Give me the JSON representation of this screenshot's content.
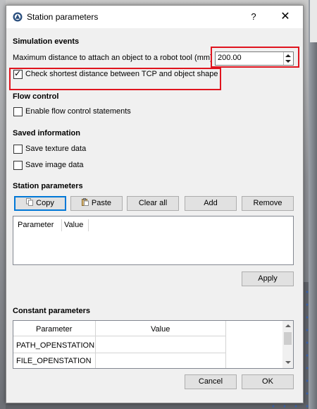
{
  "dialog": {
    "title": "Station parameters",
    "help": "?",
    "close": "✕"
  },
  "simulation_events": {
    "heading": "Simulation events",
    "max_distance_label": "Maximum distance to attach an object to a robot tool (mm)",
    "max_distance_value": "200.00",
    "check_shortest_label": "Check shortest distance between TCP and object shape",
    "check_shortest_checked": true
  },
  "flow_control": {
    "heading": "Flow control",
    "enable_label": "Enable flow control statements",
    "enable_checked": false
  },
  "saved_information": {
    "heading": "Saved information",
    "texture_label": "Save texture data",
    "image_label": "Save image data"
  },
  "station_parameters": {
    "heading": "Station parameters",
    "buttons": {
      "copy": "Copy",
      "paste": "Paste",
      "clear_all": "Clear all",
      "add": "Add",
      "remove": "Remove"
    },
    "columns": [
      "Parameter",
      "Value"
    ],
    "apply": "Apply"
  },
  "constant_parameters": {
    "heading": "Constant parameters",
    "columns": [
      "Parameter",
      "Value"
    ],
    "rows": [
      {
        "parameter": "PATH_OPENSTATION",
        "value": ""
      },
      {
        "parameter": "FILE_OPENSTATION",
        "value": ""
      }
    ]
  },
  "footer": {
    "cancel": "Cancel",
    "ok": "OK"
  },
  "colors": {
    "highlight": "#e0141e",
    "accent": "#0078d7"
  }
}
